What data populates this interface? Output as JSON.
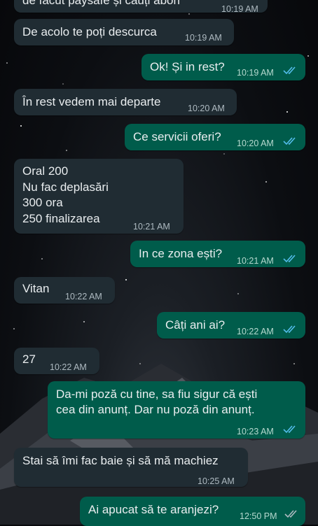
{
  "colors": {
    "incoming": "#202c33",
    "outgoing": "#005c4b",
    "read_ticks": "#53bdeb",
    "delivered_ticks": "#aebac1"
  },
  "messages": [
    {
      "dir": "in",
      "text": "de făcut paysafe și cauți abon",
      "time": "10:19 AM"
    },
    {
      "dir": "in",
      "text": "De acolo te poți descurca",
      "time": "10:19 AM"
    },
    {
      "dir": "out",
      "text": "Ok! Și in rest?",
      "time": "10:19 AM",
      "status": "read"
    },
    {
      "dir": "in",
      "text": "În rest vedem mai departe",
      "time": "10:20 AM"
    },
    {
      "dir": "out",
      "text": "Ce servicii oferi?",
      "time": "10:20 AM",
      "status": "read"
    },
    {
      "dir": "in",
      "text": "Oral 200\nNu fac deplasări\n300 ora\n250 finalizarea",
      "time": "10:21 AM"
    },
    {
      "dir": "out",
      "text": "In ce zona ești?",
      "time": "10:21 AM",
      "status": "read"
    },
    {
      "dir": "in",
      "text": "Vitan",
      "time": "10:22 AM"
    },
    {
      "dir": "out",
      "text": "Câți ani ai?",
      "time": "10:22 AM",
      "status": "read"
    },
    {
      "dir": "in",
      "text": "27",
      "time": "10:22 AM"
    },
    {
      "dir": "out",
      "text": "Da-mi poză cu tine, sa fiu sigur că ești\ncea din anunț. Dar nu poză din anunț.",
      "time": "10:23 AM",
      "status": "read"
    },
    {
      "dir": "in",
      "text": "Stai să îmi fac baie și să mă machiez",
      "time": "10:25 AM"
    },
    {
      "dir": "out",
      "text": "Ai apucat să te aranjezi?",
      "time": "12:50 PM",
      "status": "delivered"
    }
  ]
}
